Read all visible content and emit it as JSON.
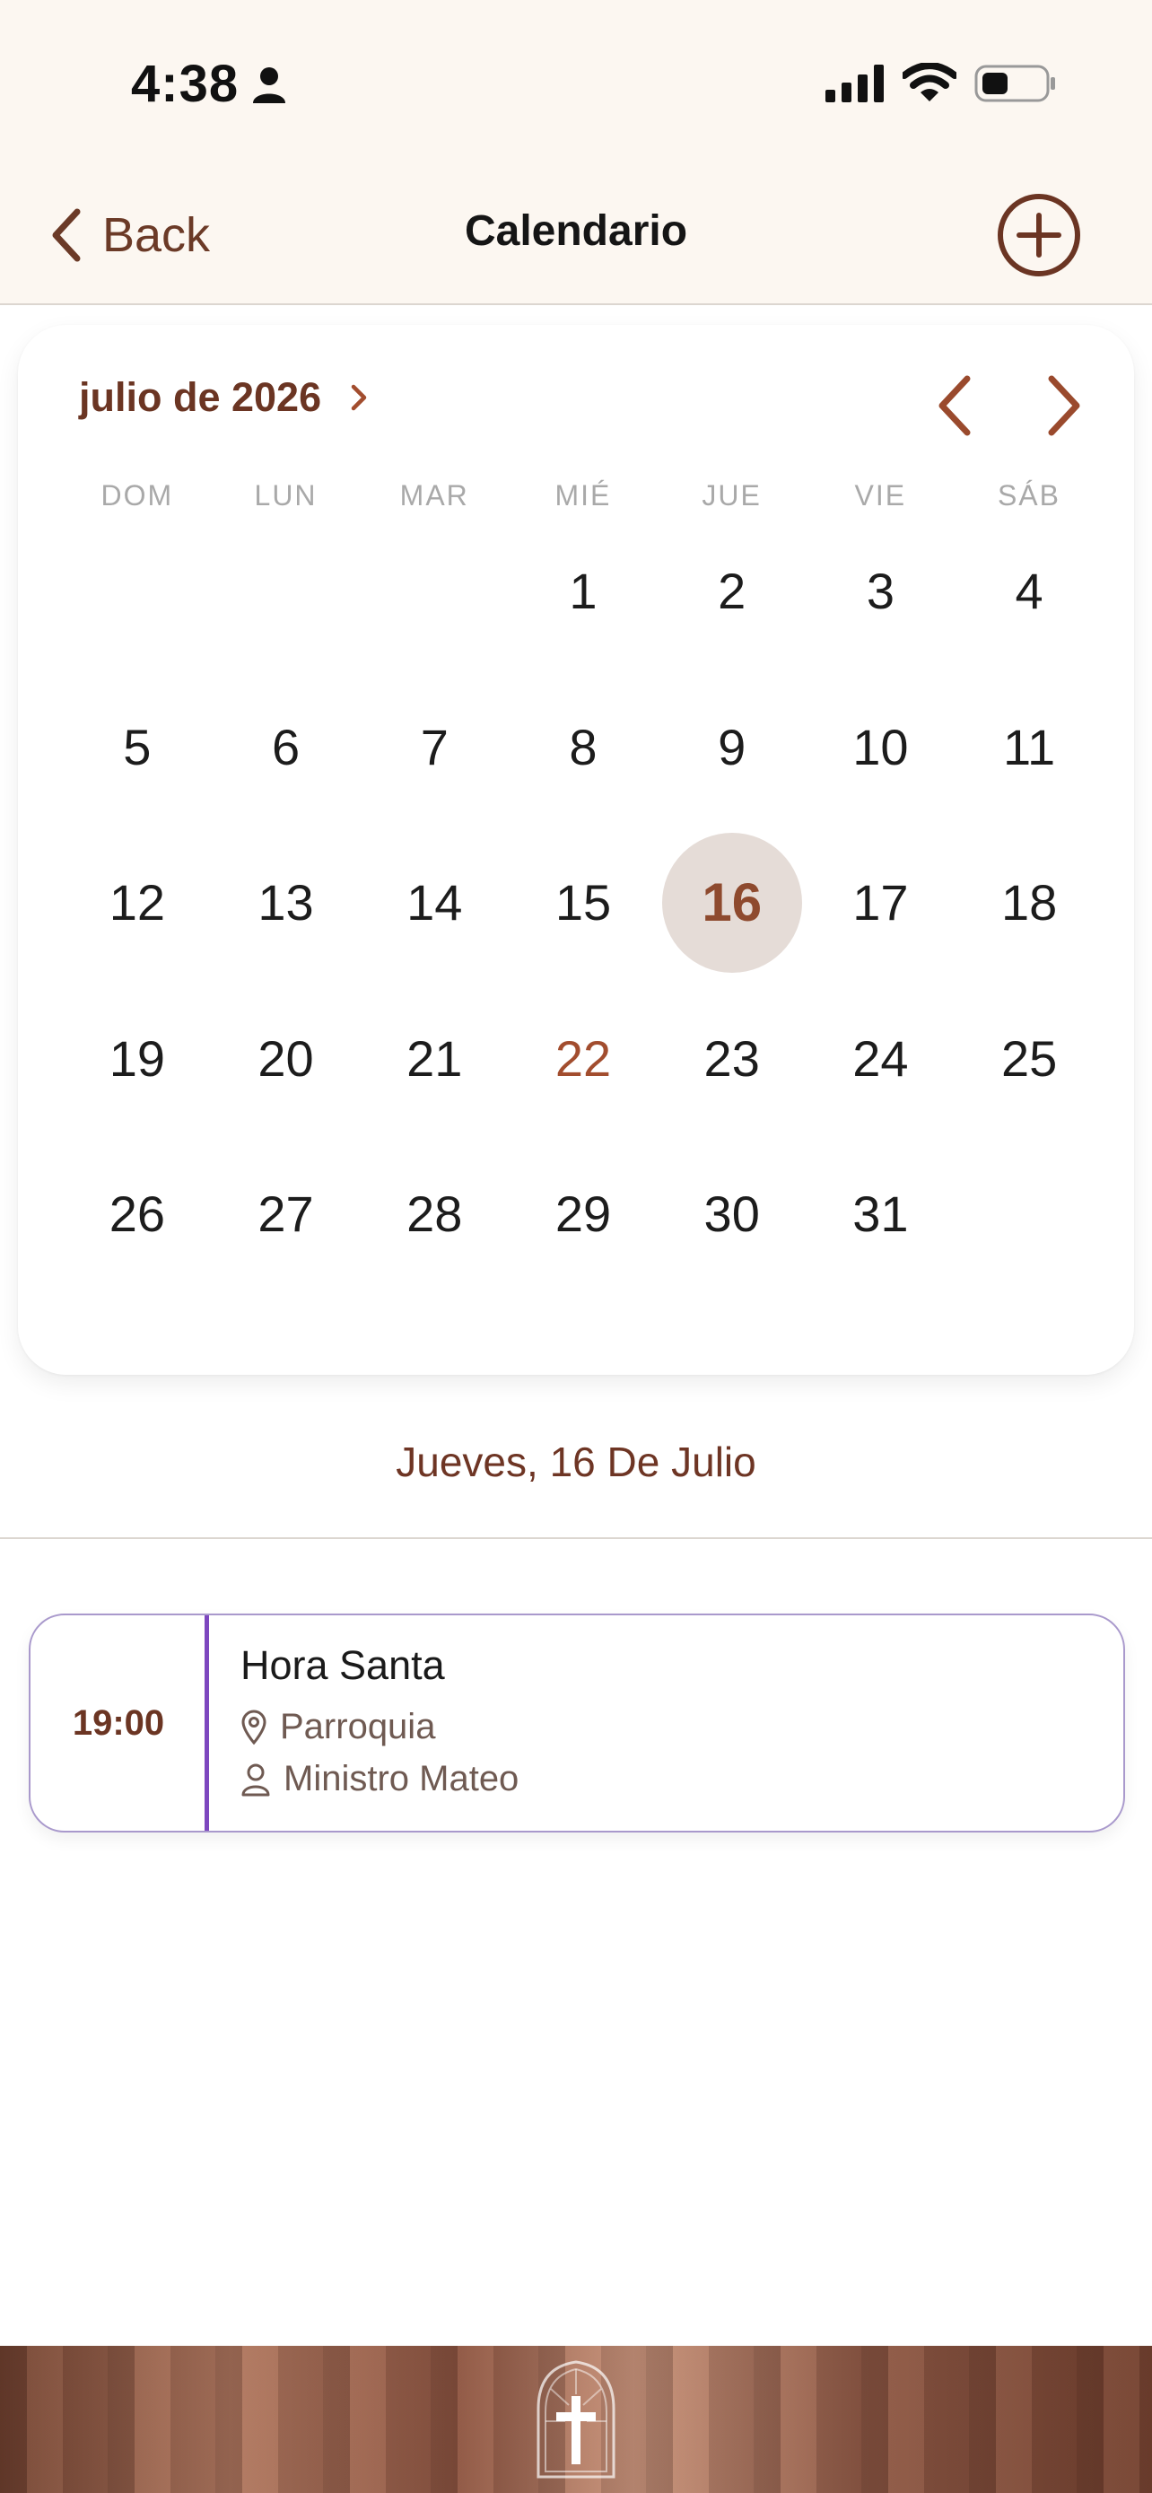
{
  "status_bar": {
    "time": "4:38"
  },
  "nav": {
    "back_label": "Back",
    "title": "Calendario"
  },
  "calendar": {
    "month_label": "julio de 2026",
    "weekdays": [
      "DOM",
      "LUN",
      "MAR",
      "MIÉ",
      "JUE",
      "VIE",
      "SÁB"
    ],
    "first_weekday_index": 3,
    "days_in_month": 31,
    "selected_day": 16,
    "event_days": [
      22
    ]
  },
  "selected_date_label": "Jueves, 16 De Julio",
  "events": [
    {
      "time": "19:00",
      "title": "Hora Santa",
      "location": "Parroquia",
      "minister": "Ministro Mateo",
      "accent_color": "#7d47bf"
    }
  ],
  "colors": {
    "accent": "#6b3523",
    "selected_bg": "#e5dcd7",
    "header_bg": "#fcf7f1",
    "event_border": "#a999cc"
  }
}
